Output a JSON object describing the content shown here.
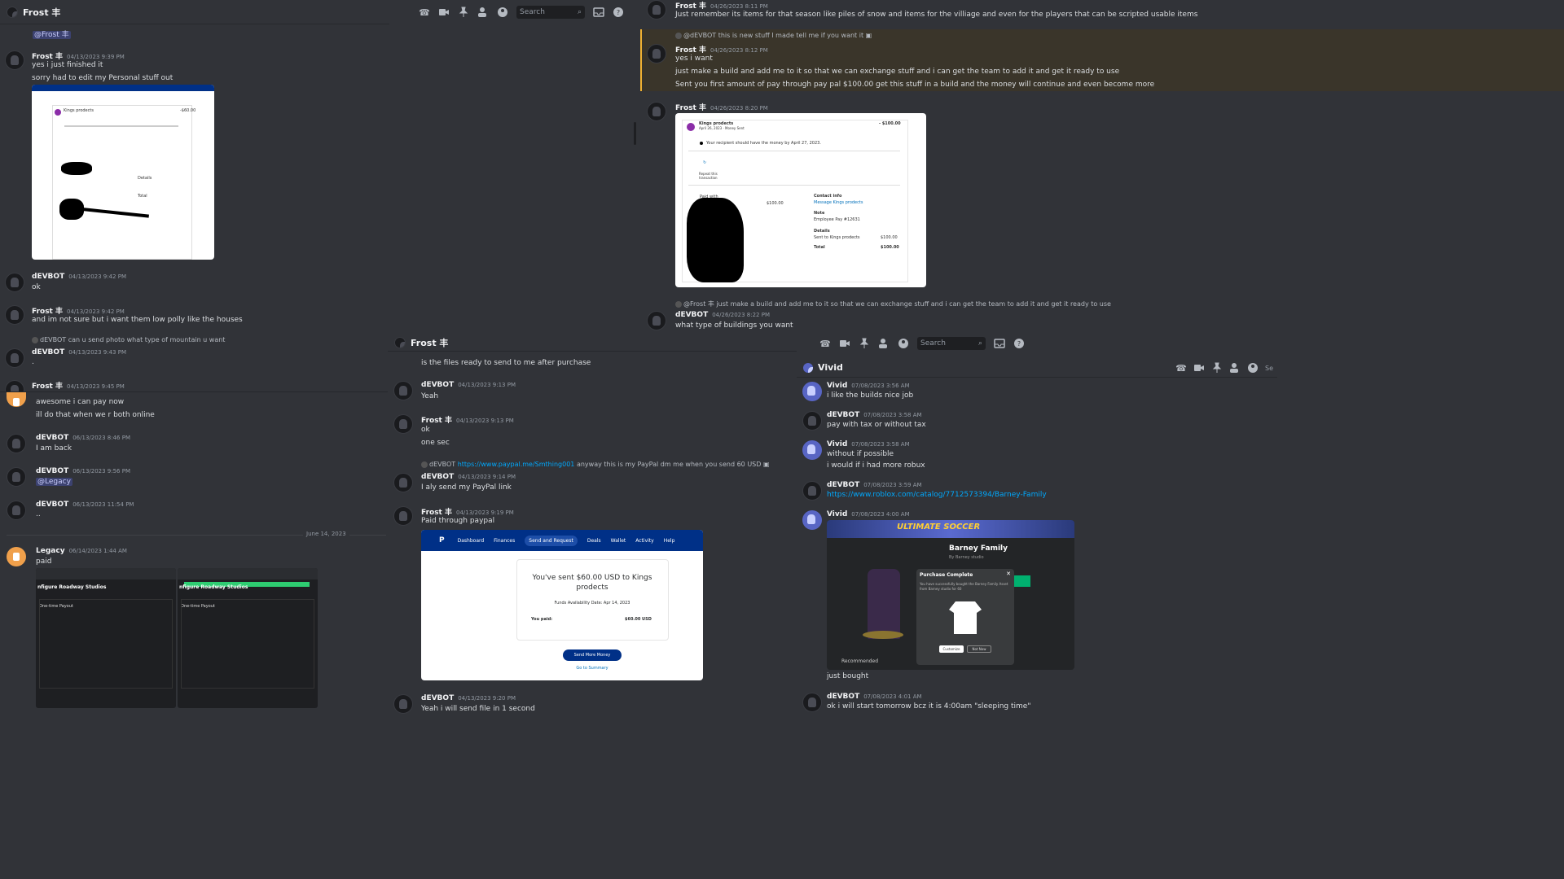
{
  "panel_a": {
    "header": {
      "title": "Frost 丰",
      "search_placeholder": "Search"
    },
    "top_mention": "@Frost 丰",
    "messages": [
      {
        "author": "Frost 丰",
        "ts": "04/13/2023 9:39 PM",
        "lines": [
          "yes i just finished it",
          "sorry had to edit my Personal stuff out"
        ]
      },
      {
        "author": "dEVBOT",
        "ts": "04/13/2023 9:42 PM",
        "lines": [
          "ok"
        ]
      },
      {
        "author": "Frost 丰",
        "ts": "04/13/2023 9:42 PM",
        "lines": [
          "and im not sure but i want them low polly like the houses"
        ]
      },
      {
        "reply_author": "dEVBOT",
        "reply_text": "can u send photo what type of mountain u want",
        "author": "dEVBOT",
        "ts": "04/13/2023 9:43 PM",
        "lines": [
          "."
        ]
      },
      {
        "author": "Frost 丰",
        "ts": "04/13/2023 9:45 PM",
        "lines": []
      },
      {
        "author": "",
        "ts": "",
        "lines": [
          "awesome i can pay now",
          "ill do that when we r both online"
        ]
      },
      {
        "author": "dEVBOT",
        "ts": "06/13/2023 8:46 PM",
        "lines": [
          "I am back"
        ]
      },
      {
        "author": "dEVBOT",
        "ts": "06/13/2023 9:56 PM",
        "mention": "@Legacy"
      },
      {
        "author": "dEVBOT",
        "ts": "06/13/2023 11:54 PM",
        "lines": [
          ".."
        ]
      },
      {
        "author": "Legacy",
        "ts": "06/14/2023 1:44 AM",
        "lines": [
          "paid"
        ]
      }
    ],
    "date_divider": "June 14, 2023",
    "receipt_small": {
      "merchant": "Kings prodects",
      "amount": "-$60.00",
      "details": "Details",
      "total": "Total"
    },
    "legacy_screens": {
      "title1": "nfigure Roadway Studios",
      "title2": "nfigure Roadway Studios",
      "label": "One-time Payout"
    }
  },
  "panel_b": {
    "messages": [
      {
        "author": "Frost 丰",
        "ts": "04/26/2023 8:11 PM",
        "lines": [
          "Just remember its items for that season like piles of snow and items for the villiage and even for the players that can be scripted usable items"
        ]
      },
      {
        "reply_author": "@dEVBOT",
        "reply_text": "this is new stuff I made tell me if you want it",
        "author": "Frost 丰",
        "ts": "04/26/2023 8:12 PM",
        "lines": [
          "yes i want",
          "just make a build and add me to it so that we can exchange stuff and i can get the team to add it and get it ready to use",
          "Sent you first amount of pay through pay pal $100.00 get this stuff in a build and the money will continue and even become more"
        ]
      },
      {
        "author": "Frost 丰",
        "ts": "04/26/2023 8:20 PM",
        "lines": []
      },
      {
        "reply_author": "@Frost 丰",
        "reply_text": "just make a build and add me to it so that we can exchange stuff and i can get the team to add it and get it ready to use",
        "author": "dEVBOT",
        "ts": "04/26/2023 8:22 PM",
        "lines": [
          "what type of buildings you want"
        ]
      }
    ],
    "receipt": {
      "merchant": "Kings prodects",
      "date": "April 26, 2023 · Money Sent",
      "amount": "- $100.00",
      "notice": "Your recipient should have the money by April 27, 2023.",
      "repeat": "Repeat this transaction",
      "paid_with": "Paid with",
      "paid_amount": "$100.00",
      "contact": "Contact info",
      "contact_link": "Message Kings prodects",
      "note": "Note",
      "note_text": "Employee Pay #12631",
      "details": "Details",
      "sent_to": "Sent to Kings prodects",
      "sent_amount": "$100.00",
      "total": "Total",
      "total_amount": "$100.00"
    }
  },
  "panel_c": {
    "header": {
      "title": "Frost 丰",
      "search_placeholder": "Search"
    },
    "messages": [
      {
        "author": "",
        "ts": "",
        "lines": [
          "is the files ready to send to me after purchase"
        ]
      },
      {
        "author": "dEVBOT",
        "ts": "04/13/2023 9:13 PM",
        "lines": [
          "Yeah"
        ]
      },
      {
        "author": "Frost 丰",
        "ts": "04/13/2023 9:13 PM",
        "lines": [
          "ok",
          "one sec"
        ]
      },
      {
        "reply_author": "dEVBOT",
        "reply_link": "https://www.paypal.me/Smthing001",
        "reply_text": "anyway this is my PayPal dm me when you send 60 USD",
        "author": "dEVBOT",
        "ts": "04/13/2023 9:14 PM",
        "lines": [
          "I aly send my PayPal link"
        ]
      },
      {
        "author": "Frost 丰",
        "ts": "04/13/2023 9:19 PM",
        "lines": [
          "Paid through paypal"
        ]
      },
      {
        "author": "dEVBOT",
        "ts": "04/13/2023 9:20 PM",
        "lines": [
          "Yeah i will send file in 1 second"
        ]
      }
    ],
    "paypal": {
      "nav": [
        "Dashboard",
        "Finances",
        "Send and Request",
        "Deals",
        "Wallet",
        "Activity",
        "Help"
      ],
      "headline": "You've sent $60.00 USD to Kings prodects",
      "funds": "Funds Availability Date: Apr 14, 2023",
      "you_paid": "You paid:",
      "amount": "$60.00 USD",
      "send_more": "Send More Money",
      "summary": "Go to Summary"
    }
  },
  "panel_d": {
    "header": {
      "title": "Vivid",
      "search_placeholder": "Se"
    },
    "messages": [
      {
        "author": "Vivid",
        "ts": "07/08/2023 3:56 AM",
        "lines": [
          "i like the builds nice job"
        ]
      },
      {
        "author": "dEVBOT",
        "ts": "07/08/2023 3:58 AM",
        "lines": [
          "pay with tax or without tax"
        ]
      },
      {
        "author": "Vivid",
        "ts": "07/08/2023 3:58 AM",
        "lines": [
          "without if possible",
          "i would if i had more robux"
        ]
      },
      {
        "author": "dEVBOT",
        "ts": "07/08/2023 3:59 AM",
        "link": "https://www.roblox.com/catalog/7712573394/Barney-Family"
      },
      {
        "author": "Vivid",
        "ts": "07/08/2023 4:00 AM",
        "lines": [
          "just bought"
        ]
      },
      {
        "author": "dEVBOT",
        "ts": "07/08/2023 4:01 AM",
        "lines": [
          "ok i will start tomorrow bcz it is 4:00am \"sleeping time\""
        ]
      }
    ],
    "roblox": {
      "banner": "ULTIMATE SOCCER",
      "item": "Barney Family",
      "by": "By Barney studio",
      "popup_title": "Purchase Complete",
      "popup_text": "You have successfully bought the Barney Family Asset from Barney studio for",
      "popup_price": "60",
      "customize": "Customize",
      "not_now": "Not Now",
      "recommended": "Recommended"
    }
  },
  "colors": {
    "bg": "#313338",
    "mention": "#3c4270",
    "link": "#00a8fc",
    "paypal_blue": "#003087",
    "highlight": "#f0b132"
  }
}
